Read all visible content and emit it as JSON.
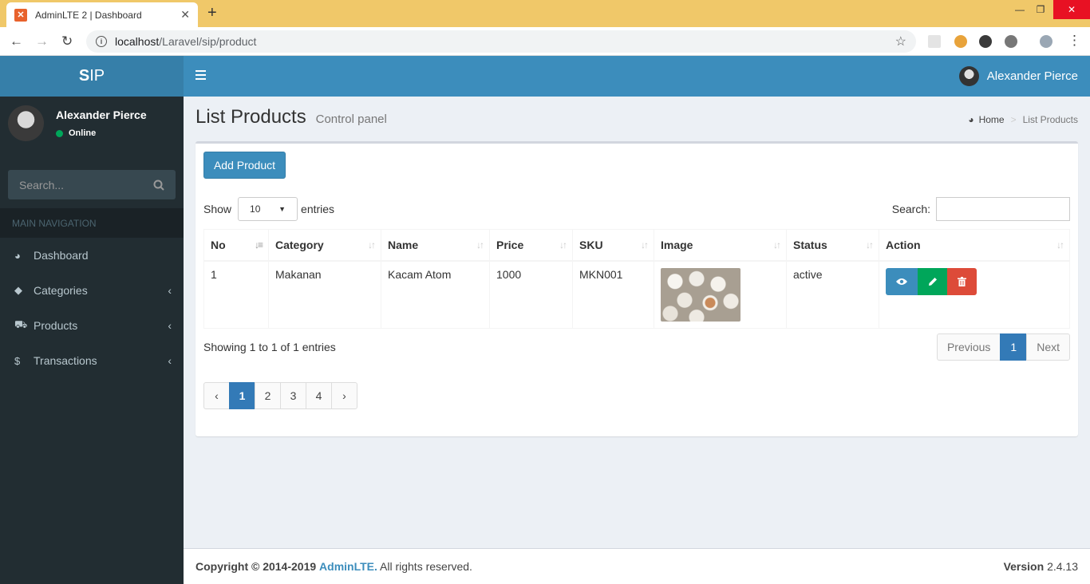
{
  "browser": {
    "tab_title": "AdminLTE 2 | Dashboard",
    "tab_close": "✕",
    "new_tab": "+",
    "url_host": "localhost",
    "url_path": "/Laravel/sip/product",
    "window_controls": {
      "minimize": "—",
      "maximize": "❐",
      "close": "✕"
    }
  },
  "sidebar": {
    "logo_bold": "S",
    "logo_rest": "IP",
    "user_name": "Alexander Pierce",
    "user_status": "Online",
    "search_placeholder": "Search...",
    "nav_header": "MAIN NAVIGATION",
    "items": [
      {
        "label": "Dashboard",
        "icon": "dashboard-icon"
      },
      {
        "label": "Categories",
        "icon": "tags-icon"
      },
      {
        "label": "Products",
        "icon": "cart-icon"
      },
      {
        "label": "Transactions",
        "icon": "dollar-icon"
      }
    ]
  },
  "topnav": {
    "user_name": "Alexander Pierce"
  },
  "header": {
    "title": "List Products",
    "subtitle": "Control panel",
    "breadcrumb": [
      "Home",
      "List Products"
    ]
  },
  "toolbar": {
    "add_label": "Add Product"
  },
  "table_controls": {
    "show_label": "Show",
    "entries_value": "10",
    "entries_label": "entries",
    "search_label": "Search:"
  },
  "table": {
    "columns": [
      "No",
      "Category",
      "Name",
      "Price",
      "SKU",
      "Image",
      "Status",
      "Action"
    ],
    "rows": [
      {
        "no": "1",
        "category": "Makanan",
        "name": "Kacam Atom",
        "price": "1000",
        "sku": "MKN001",
        "status": "active"
      }
    ]
  },
  "info_text": "Showing 1 to 1 of 1 entries",
  "dt_pager": {
    "previous": "Previous",
    "current": "1",
    "next": "Next"
  },
  "pager2": {
    "prev": "‹",
    "pages": [
      "1",
      "2",
      "3",
      "4"
    ],
    "next": "›"
  },
  "footer": {
    "copyright": "Copyright © 2014-2019",
    "brand": "AdminLTE.",
    "rights": "All rights reserved.",
    "version_label": "Version",
    "version": "2.4.13"
  },
  "colors": {
    "primary": "#3c8dbc",
    "success": "#00a65a",
    "danger": "#dd4b39",
    "sidebar": "#222d32"
  }
}
